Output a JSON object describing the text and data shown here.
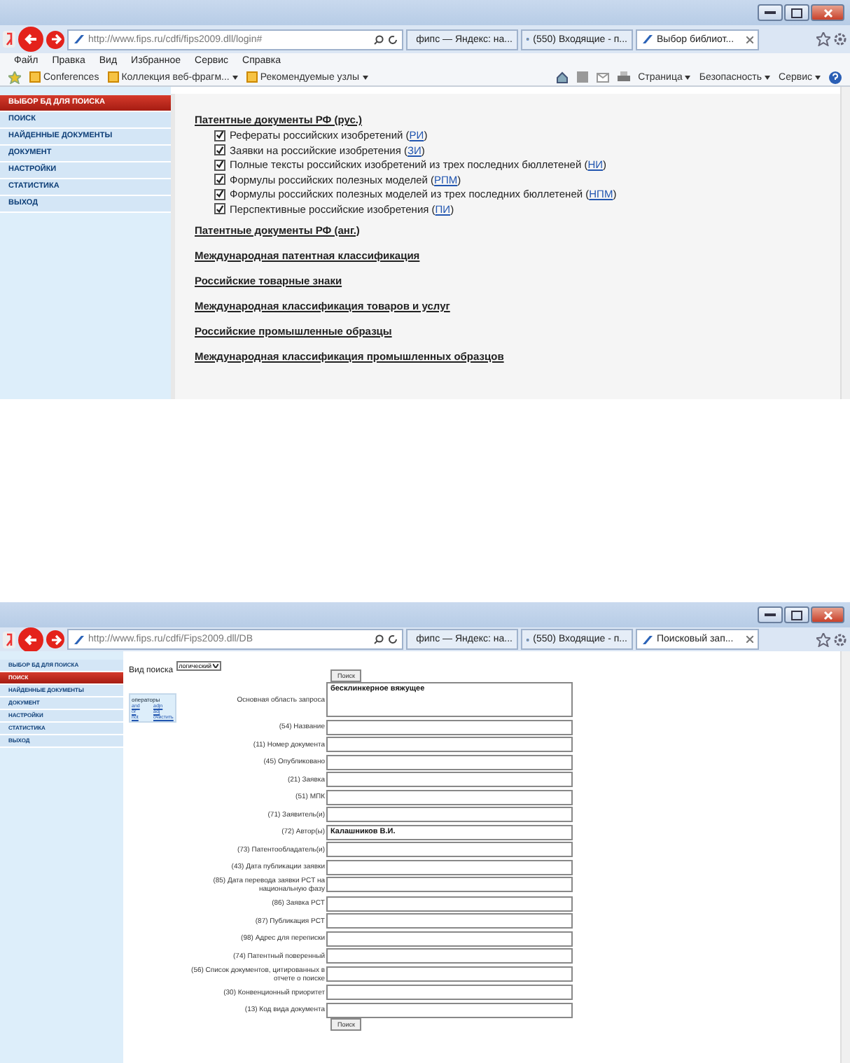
{
  "windows": [
    {
      "kind": "db_select",
      "address": "http://www.fips.ru/cdfi/fips2009.dll/login#",
      "tabs": [
        {
          "label": "фипс — Яндекс: на...",
          "selected": false
        },
        {
          "label": "(550) Входящие - п...",
          "selected": false
        },
        {
          "label": "Выбор библиот...",
          "selected": true
        }
      ],
      "menu": [
        "Файл",
        "Правка",
        "Вид",
        "Избранное",
        "Сервис",
        "Справка"
      ],
      "favorites": [
        "Conferences",
        "Коллекция веб-фрагм...",
        "Рекомендуемые узлы"
      ],
      "commands": [
        "Страница",
        "Безопасность",
        "Сервис"
      ],
      "sidebar": [
        {
          "label": "ВЫБОР БД ДЛЯ ПОИСКА",
          "selected": true
        },
        {
          "label": "ПОИСК",
          "selected": false
        },
        {
          "label": "НАЙДЕННЫЕ ДОКУМЕНТЫ",
          "selected": false
        },
        {
          "label": "ДОКУМЕНТ",
          "selected": false
        },
        {
          "label": "НАСТРОЙКИ",
          "selected": false
        },
        {
          "label": "СТАТИСТИКА",
          "selected": false
        },
        {
          "label": "ВЫХОД",
          "selected": false
        }
      ],
      "sections": [
        {
          "title": "Патентные документы РФ (рус.)",
          "databases": [
            {
              "text": "Рефераты российских изобретений (",
              "code": "РИ",
              "close": ")",
              "checked": true
            },
            {
              "text": "Заявки на российские изобретения (",
              "code": "ЗИ",
              "close": ")",
              "checked": true
            },
            {
              "text": "Полные тексты российских изобретений из трех последних бюллетеней (",
              "code": "НИ",
              "close": ")",
              "checked": true
            },
            {
              "text": "Формулы российских полезных моделей (",
              "code": "РПМ",
              "close": ")",
              "checked": true
            },
            {
              "text": "Формулы российских полезных моделей из трех последних бюллетеней (",
              "code": "НПМ",
              "close": ")",
              "checked": true
            },
            {
              "text": "Перспективные российские изобретения (",
              "code": "ПИ",
              "close": ")",
              "checked": true
            }
          ]
        },
        {
          "title": "Патентные документы РФ (анг.)"
        },
        {
          "title": "Международная патентная классификация"
        },
        {
          "title": "Российские товарные знаки"
        },
        {
          "title": "Международная классификация товаров и услуг"
        },
        {
          "title": "Российские промышленные образцы"
        },
        {
          "title": "Международная классификация промышленных образцов"
        }
      ]
    },
    {
      "kind": "search_form",
      "address": "http://www.fips.ru/cdfi/Fips2009.dll/DB",
      "tabs": [
        {
          "label": "фипс — Яндекс: на...",
          "selected": false
        },
        {
          "label": "(550) Входящие - п...",
          "selected": false
        },
        {
          "label": "Поисковый зап...",
          "selected": true
        }
      ],
      "sidebar": [
        {
          "label": "ВЫБОР БД ДЛЯ ПОИСКА",
          "selected": false
        },
        {
          "label": "ПОИСК",
          "selected": true
        },
        {
          "label": "НАЙДЕННЫЕ ДОКУМЕНТЫ",
          "selected": false
        },
        {
          "label": "ДОКУМЕНТ",
          "selected": false
        },
        {
          "label": "НАСТРОЙКИ",
          "selected": false
        },
        {
          "label": "СТАТИСТИКА",
          "selected": false
        },
        {
          "label": "ВЫХОД",
          "selected": false
        }
      ],
      "search_type": {
        "label": "Вид поиска",
        "value": "логический"
      },
      "search_button": "Поиск",
      "operators": {
        "title": "операторы",
        "links": [
          "and",
          "adjn",
          "or",
          "adj",
          "not",
          "очистить"
        ]
      },
      "query": {
        "label": "Основная область запроса",
        "value": "бесклинкерное вяжущее"
      },
      "fields": [
        {
          "label": "(54) Название"
        },
        {
          "label": "(11) Номер документа"
        },
        {
          "label": "(45) Опубликовано"
        },
        {
          "label": "(21) Заявка"
        },
        {
          "label": "(51) МПК"
        },
        {
          "label": "(71) Заявитель(и)"
        },
        {
          "label": "(72) Автор(ы)",
          "value": "Калашников В.И."
        },
        {
          "label": "(73) Патентообладатель(и)"
        },
        {
          "label": "(43) Дата публикации заявки"
        },
        {
          "label": "(85) Дата перевода заявки PCT на национальную фазу"
        },
        {
          "label": "(86) Заявка PCT"
        },
        {
          "label": "(87) Публикация PCT"
        },
        {
          "label": "(98) Адрес для переписки"
        },
        {
          "label": "(74) Патентный поверенный"
        },
        {
          "label": "(56) Список документов, цитированных в отчете о поиске"
        },
        {
          "label": "(30) Конвенционный приоритет"
        },
        {
          "label": "(13) Код вида документа"
        }
      ],
      "bottom_button": "Поиск"
    }
  ]
}
